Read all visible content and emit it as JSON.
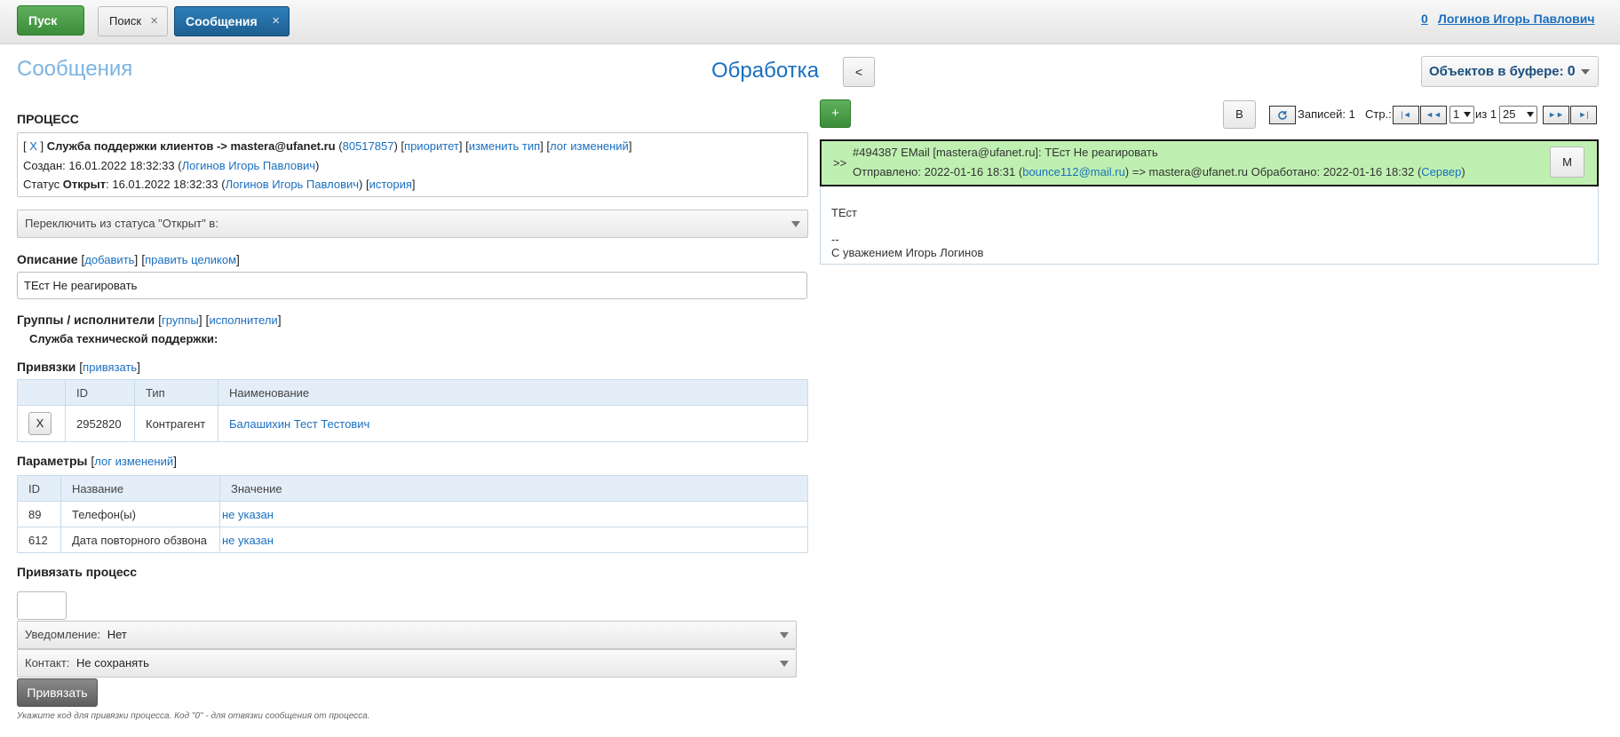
{
  "topbar": {
    "start_label": "Пуск",
    "tabs": [
      {
        "label": "Поиск",
        "close": "×"
      },
      {
        "label": "Сообщения",
        "close": "×"
      }
    ],
    "user_count": "0",
    "user_name": "Логинов Игорь Павлович"
  },
  "header": {
    "page_title": "Сообщения",
    "process_title": "Обработка",
    "back_label": "<",
    "buffer_label": "Объектов в буфере:",
    "buffer_count": "0"
  },
  "process": {
    "section_label": "ПРОЦЕСС",
    "line1": {
      "bracket_open": "[",
      "close_link": "X",
      "bracket_close": "]",
      "title": "Служба поддержки клиентов -> mastera@ufanet.ru",
      "paren_open": "(",
      "id_link": "80517857",
      "paren_close": ")",
      "priority_link": "приоритет",
      "change_type_link": "изменить тип",
      "log_link": "лог изменений"
    },
    "line2": {
      "created_label": "Создан: 16.01.2022 18:32:33 (",
      "created_by": "Логинов Игорь Павлович",
      "end": ")"
    },
    "line3": {
      "status_label": "Статус",
      "status_value": "Открыт",
      "status_date": ": 16.01.2022 18:32:33 (",
      "status_by": "Логинов Игорь Павлович",
      "mid": ") [",
      "history_link": "история",
      "end": "]"
    },
    "switch_status_placeholder": "Переключить из статуса \"Открыт\" в:"
  },
  "description": {
    "label": "Описание",
    "add_link": "добавить",
    "edit_link": "править целиком",
    "value": "ТЕст Не реагировать"
  },
  "groups": {
    "label": "Группы / исполнители",
    "groups_link": "группы",
    "executors_link": "исполнители",
    "item": "Служба технической поддержки:"
  },
  "links": {
    "label": "Привязки",
    "bind_link": "привязать",
    "columns": [
      "",
      "ID",
      "Тип",
      "Наименование"
    ],
    "rows": [
      {
        "btn": "X",
        "id": "2952820",
        "type": "Контрагент",
        "name": "Балашихин Тест Тестович"
      }
    ]
  },
  "params": {
    "label": "Параметры",
    "log_link": "лог изменений",
    "columns": [
      "ID",
      "Название",
      "Значение"
    ],
    "rows": [
      {
        "id": "89",
        "name": "Телефон(ы)",
        "value": "не указан"
      },
      {
        "id": "612",
        "name": "Дата повторного обзвона",
        "value": "не указан"
      }
    ]
  },
  "bind_process": {
    "label": "Привязать процесс",
    "notify_label": "Уведомление:",
    "notify_value": "Нет",
    "contact_label": "Контакт:",
    "contact_value": "Не сохранять",
    "submit_label": "Привязать",
    "hint": "Укажите код для привязки процесса. Код \"0\" - для отвязки сообщения от процесса."
  },
  "toolbar": {
    "add_label": "+",
    "b_label": "B",
    "records_label": "Записей: 1",
    "page_label": "Стр.:",
    "page_value": "1",
    "of_label": "из 1",
    "page_size": "25",
    "nav": {
      "first": "|◄",
      "prev": "◄◄",
      "next": "►►",
      "last": "►|"
    }
  },
  "message": {
    "expand": ">>",
    "header": "#494387 EMail [mastera@ufanet.ru]: ТЕст Не реагировать",
    "sent_label": "Отправлено: 2022-01-16 18:31 (",
    "sender": "bounce112@mail.ru",
    "mid": ") => mastera@ufanet.ru Обработано: 2022-01-16 18:32 (",
    "processor": "Сервер",
    "end": ")",
    "m_button": "M",
    "body": [
      "ТЕст",
      "",
      "--",
      "С уважением Игорь Логинов"
    ]
  },
  "colors": {
    "accent": "#1a6fbf",
    "start_green": "#4a9e47",
    "tab_blue": "#2771a8",
    "message_header": "#bff0b1"
  }
}
